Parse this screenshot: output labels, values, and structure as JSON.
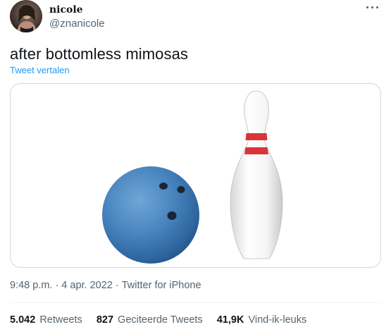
{
  "author": {
    "display_name": "nicole",
    "handle": "@znanicole",
    "avatar_icon": "profile-photo"
  },
  "more_icon": "more-horizontal-icon",
  "tweet": {
    "text": "after bottomless mimosas",
    "translate_label": "Tweet vertalen"
  },
  "media": {
    "description_icons": [
      "bowling-ball-icon",
      "bowling-pin-icon"
    ]
  },
  "meta": {
    "time": "9:48 p.m.",
    "separator": "·",
    "date": "4 apr. 2022",
    "source": "Twitter for iPhone"
  },
  "stats": {
    "retweets_count": "5.042",
    "retweets_label": "Retweets",
    "quotes_count": "827",
    "quotes_label": "Geciteerde Tweets",
    "likes_count": "41,9K",
    "likes_label": "Vind-ik-leuks"
  },
  "colors": {
    "link": "#1d9bf0",
    "secondary_text": "#536471",
    "primary_text": "#0f1419",
    "border": "#cfd9de"
  }
}
